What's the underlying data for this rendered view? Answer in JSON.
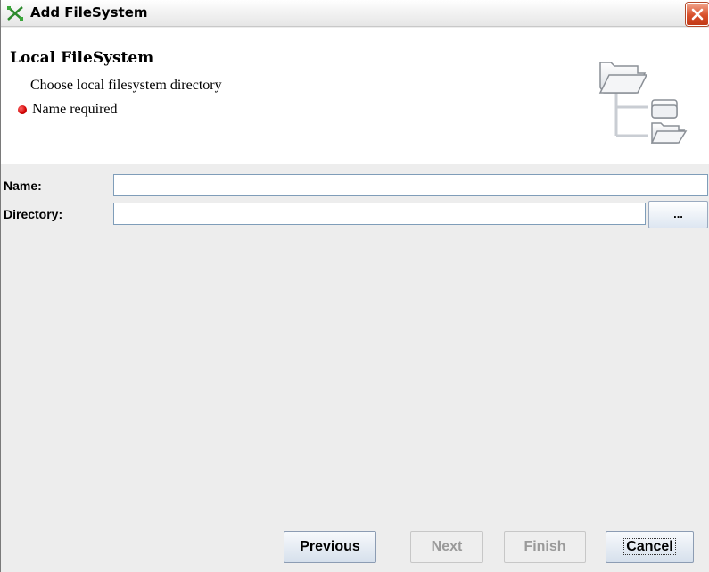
{
  "window": {
    "title": "Add FileSystem",
    "close_icon": "close-icon"
  },
  "header": {
    "title": "Local FileSystem",
    "subtitle": "Choose local filesystem directory",
    "status_text": "Name required",
    "status_color": "#d10000",
    "graphic_icon": "folder-tree-icon"
  },
  "form": {
    "name_label": "Name:",
    "name_value": "",
    "directory_label": "Directory:",
    "directory_value": "",
    "browse_label": "..."
  },
  "buttons": {
    "previous": "Previous",
    "next": "Next",
    "finish": "Finish",
    "cancel": "Cancel"
  }
}
